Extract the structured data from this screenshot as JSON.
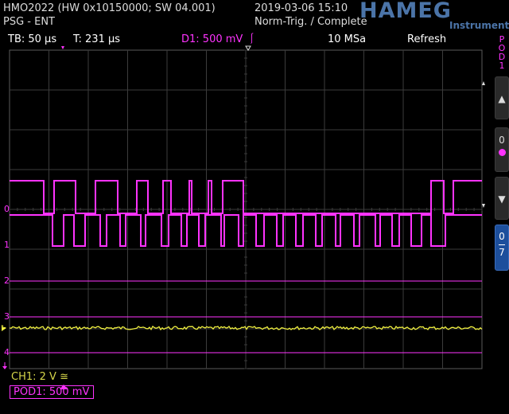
{
  "header": {
    "model": "HMO2022 (HW 0x10150000; SW 04.001)",
    "mode": "PSG - ENT",
    "datetime": "2019-03-06 15:10",
    "trigger_status": "Norm-Trig. / Complete",
    "brand": "HAMEG",
    "brand_sub": "Instruments"
  },
  "toolbar": {
    "timebase": "TB: 50 µs",
    "trigger_time": "T: 231 µs",
    "trigger_source": "D1: 500 mV",
    "trigger_edge_symbol": "⎰",
    "sample_rate": "10 MSa",
    "refresh": "Refresh"
  },
  "side_panel": {
    "pod_label": [
      "P",
      "O",
      "D",
      "1"
    ],
    "up_arrow": "▲",
    "zero_label": "0",
    "down_arrow": "▼",
    "range_top": "0",
    "range_bottom": "7"
  },
  "channels": {
    "labels": [
      "0",
      "1",
      "2",
      "3",
      "4"
    ],
    "ch1_marker": "1",
    "footer_ch1": "CH1: 2 V ≅",
    "footer_pod": "POD1: 500 mV"
  },
  "colors": {
    "logic": "#ff33ff",
    "ch1": "#f0f040",
    "grid": "#3c3c3c",
    "brand": "#4b74a8"
  }
}
